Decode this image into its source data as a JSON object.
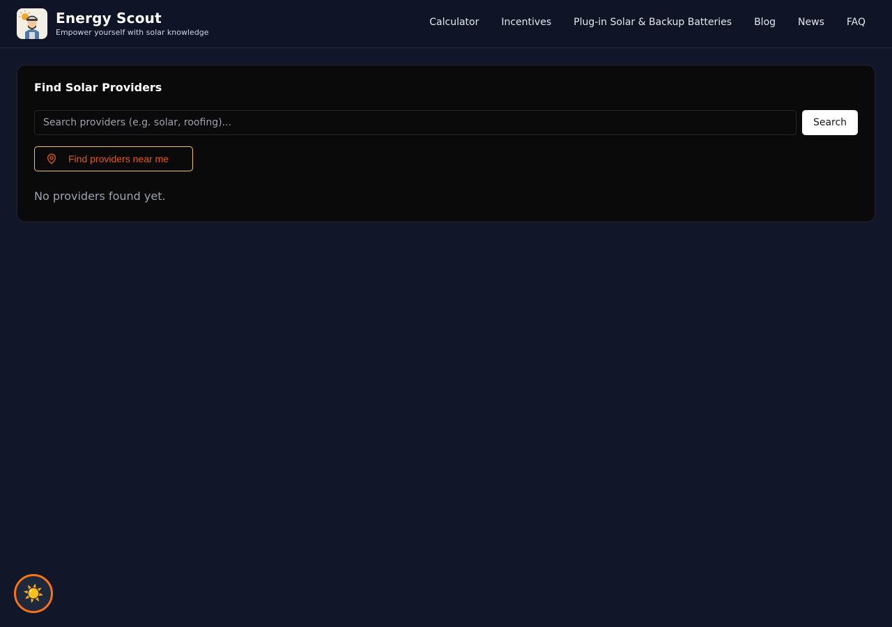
{
  "header": {
    "brand_title": "Energy Scout",
    "brand_subtitle": "Empower yourself with solar knowledge",
    "logo_icon": "solar-mascot-icon",
    "nav": [
      {
        "label": "Calculator"
      },
      {
        "label": "Incentives"
      },
      {
        "label": "Plug-in Solar & Backup Batteries"
      },
      {
        "label": "Blog"
      },
      {
        "label": "News"
      },
      {
        "label": "FAQ"
      }
    ]
  },
  "finder": {
    "title": "Find Solar Providers",
    "search_placeholder": "Search providers (e.g. solar, roofing)...",
    "search_value": "",
    "search_button": "Search",
    "near_button": "Find providers near me",
    "near_icon": "map-pin-icon",
    "empty_message": "No providers found yet."
  },
  "theme_toggle": {
    "icon": "sun-icon",
    "glyph": "☀️"
  },
  "colors": {
    "background": "#111729",
    "card": "#0a0a0b",
    "accent_orange": "#ea580c",
    "accent_border": "#f5c16c",
    "toggle_ring": "#f97316"
  }
}
